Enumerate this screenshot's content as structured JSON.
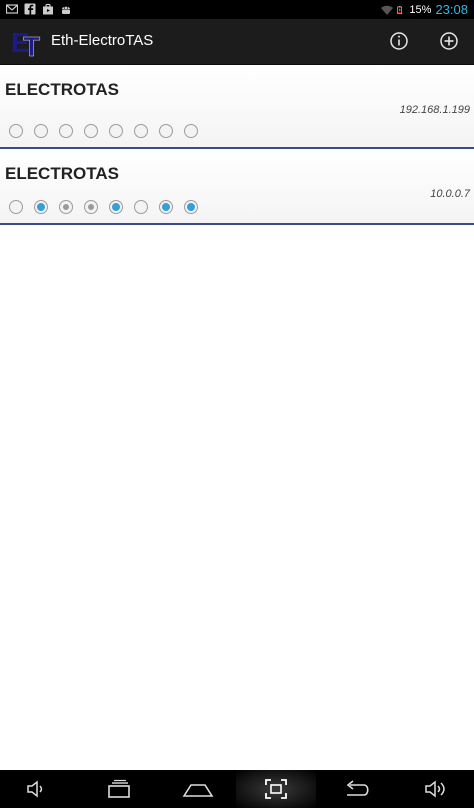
{
  "status_bar": {
    "left_icons": [
      "gmail-icon",
      "facebook-icon",
      "shop-icon",
      "android-icon"
    ],
    "battery_percent": "15%",
    "time": "23:08"
  },
  "action_bar": {
    "title": "Eth-ElectroTAS",
    "logo_text": "ET",
    "info_icon": "info-icon",
    "add_icon": "add-icon"
  },
  "devices": [
    {
      "name": "ELECTROTAS",
      "ip": "192.168.1.199",
      "channels": [
        "off",
        "off",
        "off",
        "off",
        "off",
        "off",
        "off",
        "off"
      ]
    },
    {
      "name": "ELECTROTAS",
      "ip": "10.0.0.7",
      "channels": [
        "off",
        "on",
        "dim",
        "dim",
        "on",
        "off",
        "on",
        "on"
      ]
    }
  ],
  "nav_bar": {
    "buttons": [
      "volume-down-icon",
      "recent-apps-icon",
      "home-icon",
      "screenshot-icon",
      "back-icon",
      "volume-up-icon"
    ]
  },
  "colors": {
    "accent": "#33b5e5",
    "radio_on": "#33a0d8",
    "divider": "#3c4a8c",
    "action_bar": "#1c1c1c"
  }
}
